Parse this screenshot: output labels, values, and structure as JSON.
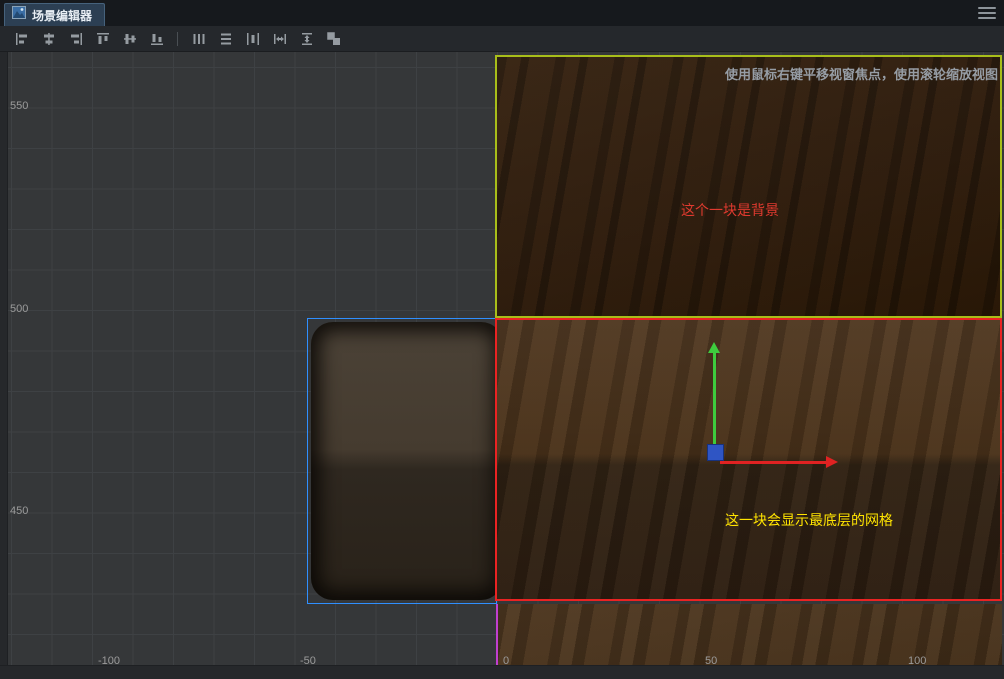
{
  "window": {
    "tab_label": "场景编辑器",
    "tab_icon": "scene-image-icon",
    "menu_icon": "hamburger-menu-icon"
  },
  "toolbar": {
    "icons": [
      "align-left",
      "align-h-center",
      "align-right",
      "align-top",
      "align-v-center",
      "align-bottom",
      "distribute-horizontal",
      "distribute-vertical",
      "equal-spacing",
      "equal-width",
      "equal-height",
      "equal-size"
    ]
  },
  "viewport": {
    "hint": "使用鼠标右键平移视窗焦点，使用滚轮缩放视图",
    "background_block_label": "这个一块是背景",
    "grid_block_label": "这一块会显示最底层的网格",
    "y_axis_labels": [
      "550",
      "500",
      "450"
    ],
    "x_axis_labels": [
      "-100",
      "-50",
      "0",
      "50",
      "100"
    ],
    "colors": {
      "background_box_border": "#a8be1a",
      "grid_box_border": "#ea2323",
      "selection_border": "#2f8fff",
      "axis_x0_line": "#c03fd0",
      "background_label_color": "#e03a2f",
      "grid_label_color": "#ffe400",
      "gizmo_x_axis": "#e02222",
      "gizmo_y_axis": "#3ecc3e",
      "gizmo_origin": "#2f55c4"
    }
  }
}
